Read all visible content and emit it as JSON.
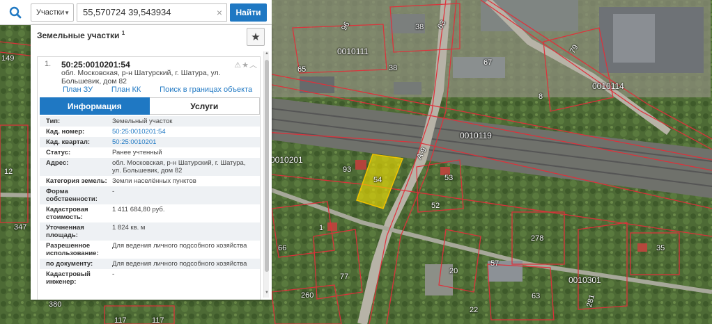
{
  "search": {
    "category": "Участки",
    "query": "55,570724 39,543934",
    "find_label": "Найти"
  },
  "panel": {
    "title": "Земельные участки",
    "title_sup": "1"
  },
  "result": {
    "number": "1.",
    "cad_number": "50:25:0010201:54",
    "address": "обл. Московская, р-н Шатурский, г. Шатура, ул. Большевик, дом 82",
    "links": [
      "План ЗУ →",
      "План КК →",
      "Поиск в границах объекта →"
    ],
    "tabs": {
      "info": "Информация",
      "services": "Услуги"
    },
    "props": [
      {
        "k": "Тип:",
        "v": "Земельный участок"
      },
      {
        "k": "Кад. номер:",
        "v": "50:25:0010201:54"
      },
      {
        "k": "Кад. квартал:",
        "v": "50:25:0010201"
      },
      {
        "k": "Статус:",
        "v": "Ранее учтенный"
      },
      {
        "k": "Адрес:",
        "v": "обл. Московская, р-н Шатурский, г. Шатура, ул. Большевик, дом 82"
      },
      {
        "k": "Категория земель:",
        "v": "Земли населённых пунктов"
      },
      {
        "k": "Форма собственности:",
        "v": "-"
      },
      {
        "k": "Кадастровая стоимость:",
        "v": "1 411 684,80 руб."
      },
      {
        "k": "Уточненная площадь:",
        "v": "1 824 кв. м"
      },
      {
        "k": "Разрешенное использование:",
        "v": "Для ведения личного подсобного хозяйства"
      },
      {
        "k": "по документу:",
        "v": "Для ведения личного подсобного хозяйства"
      },
      {
        "k": "Кадастровый инженер:",
        "v": "-"
      }
    ]
  },
  "map_labels": {
    "l1": "0010111",
    "l2": "0010114",
    "l3": "0010119",
    "l4": "0010201",
    "l5": "0010301",
    "n38a": "38",
    "n38b": "38",
    "n96": "96",
    "n63": "63",
    "n65": "65",
    "n67": "67",
    "n79": "79",
    "n8": "8",
    "n93": "93",
    "n54": "54",
    "n53": "53",
    "n52": "52",
    "n278": "278",
    "n35": "35",
    "n12": "12",
    "n347": "347",
    "n1": "1",
    "n66": "66",
    "n77": "77",
    "n20": "20",
    "n57": "57",
    "n63b": "63",
    "n260": "260",
    "n117a": "117",
    "n117b": "117",
    "n22": "22",
    "n281": "281",
    "n380": "380",
    "n149": "149",
    "road": "A-9"
  },
  "colors": {
    "accent": "#1f78c3",
    "parcel_highlight": "#f5e100",
    "boundary": "#e0303a"
  }
}
